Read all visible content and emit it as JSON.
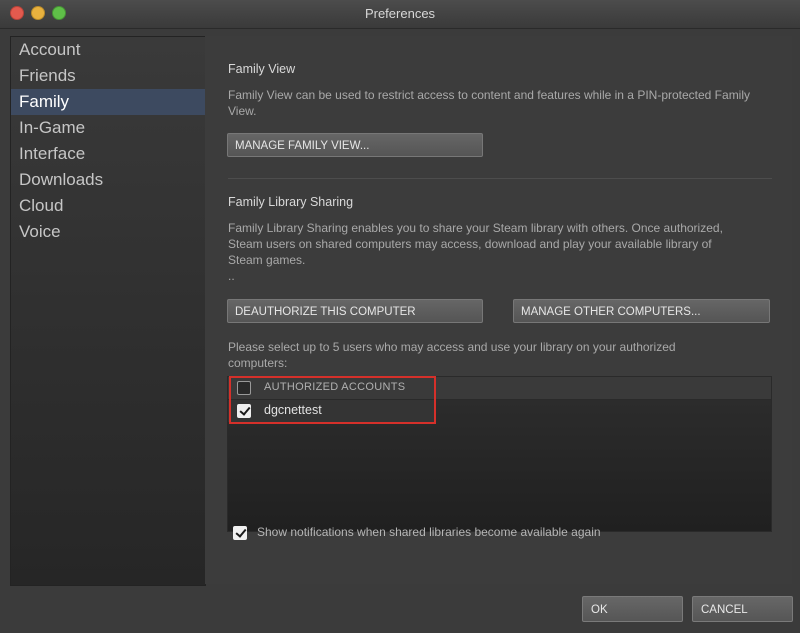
{
  "window": {
    "title": "Preferences"
  },
  "sidebar": {
    "items": [
      {
        "label": "Account"
      },
      {
        "label": "Friends"
      },
      {
        "label": "Family"
      },
      {
        "label": "In-Game"
      },
      {
        "label": "Interface"
      },
      {
        "label": "Downloads"
      },
      {
        "label": "Cloud"
      },
      {
        "label": "Voice"
      }
    ],
    "active": "Family"
  },
  "family_view": {
    "title": "Family View",
    "description": "Family View can be used to restrict access to content and features while in a PIN-protected Family View.",
    "manage_button": "MANAGE FAMILY VIEW..."
  },
  "library_sharing": {
    "title": "Family Library Sharing",
    "description": "Family Library Sharing enables you to share your Steam library with others. Once authorized, Steam users on shared computers may access, download and play your available library of Steam games.",
    "ellipsis": "..",
    "deauthorize_button": "DEAUTHORIZE THIS COMPUTER",
    "manage_computers_button": "MANAGE OTHER COMPUTERS...",
    "select_prompt": "Please select up to 5 users who may access and use your library on your authorized computers:",
    "accounts_header": "AUTHORIZED ACCOUNTS",
    "accounts": [
      {
        "name": "dgcnettest",
        "checked": true
      }
    ],
    "notifications_label": "Show notifications when shared libraries become available again",
    "notifications_checked": true
  },
  "footer": {
    "ok_label": "OK",
    "cancel_label": "CANCEL"
  },
  "colors": {
    "highlight_box": "#d5302a",
    "active_sidebar": "#3d4a60"
  }
}
